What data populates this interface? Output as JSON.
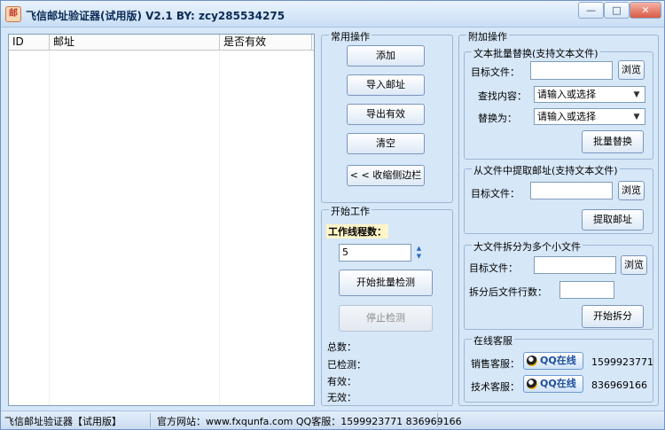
{
  "window": {
    "title": "飞信邮址验证器(试用版) V2.1   BY: zcy285534275",
    "icon_text": "邮",
    "controls": {
      "minimize": "—",
      "maximize": "□",
      "close": "✕"
    }
  },
  "list": {
    "columns": [
      "ID",
      "邮址",
      "是否有效"
    ]
  },
  "common_ops": {
    "legend": "常用操作",
    "add": "添加",
    "import_email": "导入邮址",
    "export_valid": "导出有效",
    "clear": "清空",
    "collapse_sidebar": "< < 收缩侧边栏"
  },
  "start_work": {
    "legend": "开始工作",
    "threads_label": "工作线程数：",
    "threads_value": "5",
    "start_batch": "开始批量检测",
    "stop_check": "停止检测",
    "total_label": "总数：",
    "checked_label": "已检测：",
    "valid_label": "有效：",
    "invalid_label": "无效："
  },
  "extra_ops": {
    "legend": "附加操作",
    "batch_replace": {
      "legend": "文本批量替换(支持文本文件)",
      "target_label": "目标文件：",
      "browse": "浏览",
      "find_label": "查找内容：",
      "find_placeholder": "请输入或选择",
      "replace_label": "替换为：",
      "replace_placeholder": "请输入或选择",
      "action": "批量替换"
    },
    "extract": {
      "legend": "从文件中提取邮址(支持文本文件)",
      "target_label": "目标文件：",
      "browse": "浏览",
      "action": "提取邮址"
    },
    "split": {
      "legend": "大文件拆分为多个小文件",
      "target_label": "目标文件：",
      "browse": "浏览",
      "lines_label": "拆分后文件行数：",
      "action": "开始拆分"
    },
    "support": {
      "legend": "在线客服",
      "sales_label": "销售客服：",
      "sales_badge": "QQ在线",
      "sales_qq": "1599923771",
      "tech_label": "技术客服：",
      "tech_badge": "QQ在线",
      "tech_qq": "836969166"
    }
  },
  "status": {
    "app_name": "飞信邮址验证器【试用版】",
    "website": "官方网站：www.fxqunfa.com  QQ客服：1599923771  836969166"
  }
}
